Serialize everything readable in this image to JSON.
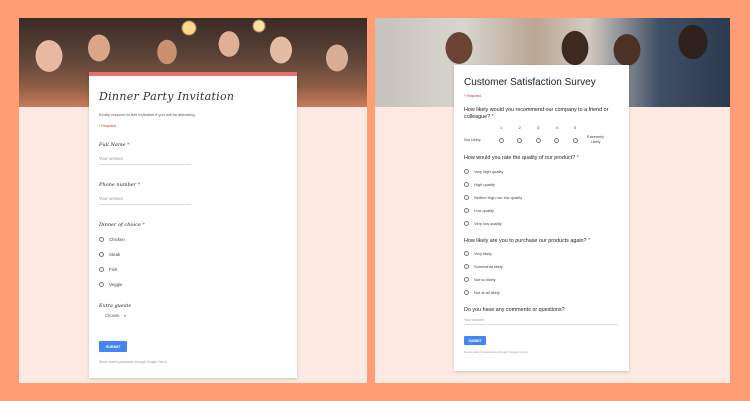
{
  "dinner_form": {
    "title": "Dinner Party Invitation",
    "description": "Kindly respond to this invitation if you will be attending.",
    "required_note": "* Required",
    "full_name_label": "Full Name",
    "phone_label": "Phone number",
    "dinner_label": "Dinner of choice",
    "required_star": "*",
    "answer_placeholder": "Your answer",
    "dinner_options": [
      "Chicken",
      "Steak",
      "Fish",
      "Veggie"
    ],
    "extra_guests_label": "Extra guests",
    "extra_guests_value": "Choose",
    "submit_label": "SUBMIT",
    "footer": "Never submit passwords through Google Forms."
  },
  "survey_form": {
    "title": "Customer Satisfaction Survey",
    "required_note": "* Required",
    "q1_label": "How likely would you recommend our company to a friend or colleague?",
    "required_star": "*",
    "scale_numbers": [
      "1",
      "2",
      "3",
      "4",
      "5"
    ],
    "scale_low": "Not Likely",
    "scale_high": "Extremely Likely",
    "q2_label": "How would you rate the quality of our product?",
    "q2_options": [
      "Very high quality",
      "High quality",
      "Neither high nor low quality",
      "Low quality",
      "Very low quality"
    ],
    "q3_label": "How likely are you to purchase our products again?",
    "q3_options": [
      "Very likely",
      "Somewhat likely",
      "Not so likely",
      "Not at all likely"
    ],
    "q4_label": "Do you have any comments or questions?",
    "answer_placeholder": "Your answer",
    "submit_label": "SUBMIT",
    "footer": "Never submit passwords through Google Forms."
  },
  "colors": {
    "page_background": "#ff9e74",
    "panel_background": "#fce9e2",
    "accent_blue": "#4285f4",
    "required_red": "#d93025",
    "dinner_header_bar": "#e57373"
  }
}
